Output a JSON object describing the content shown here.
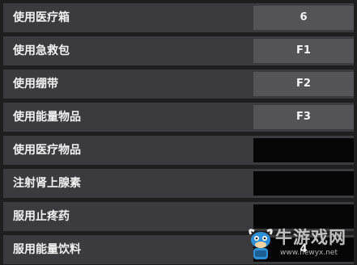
{
  "bindings": [
    {
      "action": "使用医疗箱",
      "key": "6"
    },
    {
      "action": "使用急救包",
      "key": "F1"
    },
    {
      "action": "使用绷带",
      "key": "F2"
    },
    {
      "action": "使用能量物品",
      "key": "F3"
    },
    {
      "action": "使用医疗物品",
      "key": ""
    },
    {
      "action": "注射肾上腺素",
      "key": ""
    },
    {
      "action": "服用止疼药",
      "key": ""
    },
    {
      "action": "服用能量饮料",
      "key": "4"
    }
  ],
  "watermark": {
    "name": "牛游戏网",
    "url": "www.newyx.net",
    "icon": "cow-mascot-icon"
  }
}
